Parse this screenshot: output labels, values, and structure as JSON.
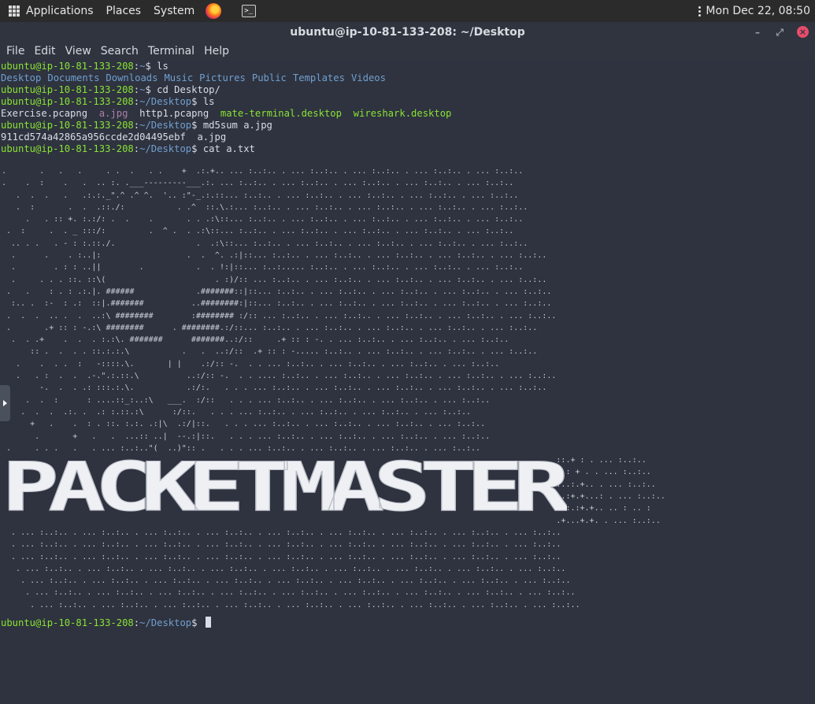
{
  "topbar": {
    "applications": "Applications",
    "places": "Places",
    "system": "System",
    "clock": "Mon Dec 22, 08:50"
  },
  "window": {
    "title": "ubuntu@ip-10-81-133-208: ~/Desktop"
  },
  "menu": {
    "file": "File",
    "edit": "Edit",
    "view": "View",
    "search": "Search",
    "terminal": "Terminal",
    "help": "Help"
  },
  "terminal": {
    "prompt_user": "ubuntu@ip-10-81-133-208",
    "cmd1": "ls",
    "ls_home": [
      "Desktop",
      "Documents",
      "Downloads",
      "Music",
      "Pictures",
      "Public",
      "Templates",
      "Videos"
    ],
    "cmd2": "cd Desktop/",
    "path_home": "~",
    "path_desktop": "~/Desktop",
    "cmd3": "ls",
    "ls_desktop": {
      "f1": "Exercise.pcapng",
      "f2": "a.jpg",
      "f3": "http1.pcapng",
      "f4": "mate-terminal.desktop",
      "f5": "wireshark.desktop"
    },
    "cmd4": "md5sum a.jpg",
    "md5_output": "911cd574a42865a956ccde2d04495ebf  a.jpg",
    "cmd5": "cat a.txt",
    "banner": "PACKETMASTER"
  }
}
